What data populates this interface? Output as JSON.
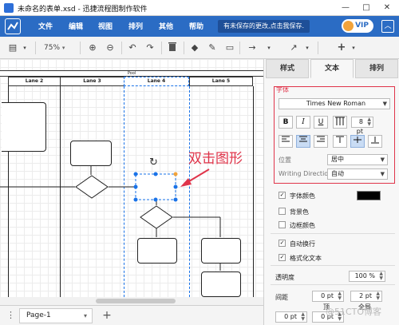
{
  "window": {
    "title": "未命名的表单.xsd - 迅捷流程图制作软件",
    "min_glyph": "—",
    "max_glyph": "□",
    "close_glyph": "✕"
  },
  "menubar": {
    "items": [
      "文件",
      "编辑",
      "视图",
      "排列",
      "其他",
      "帮助"
    ],
    "notice": "有未保存的更改,点击我保存.",
    "vip_label": "VIP",
    "collapse_glyph": "︿"
  },
  "toolbar": {
    "zoom": "75%",
    "icons": [
      "panel-toggle-icon",
      "zoom-in-icon",
      "zoom-out-icon",
      "undo-icon",
      "redo-icon",
      "delete-icon",
      "fill-color-icon",
      "line-color-icon",
      "shadow-icon",
      "connector-icon",
      "waypoint-icon",
      "insert-icon"
    ],
    "glyphs": {
      "panel": "▤",
      "zoom_in": "⊕",
      "zoom_out": "⊖",
      "undo": "↶",
      "redo": "↷",
      "delete": "🗑",
      "fill": "◆",
      "line": "✎",
      "shadow": "▭",
      "connector": "→",
      "waypoint": "↗",
      "insert": "+"
    }
  },
  "canvas": {
    "pool_label": "Pool",
    "lanes": [
      "Lane 2",
      "Lane 3",
      "Lane 4",
      "Lane 5"
    ],
    "rotate_glyph": "↻"
  },
  "annotation": {
    "text": "双击图形"
  },
  "pagebar": {
    "more_glyph": "⋮",
    "tab_label": "Page-1",
    "tab_dropdown": "▾",
    "add_glyph": "+"
  },
  "panel": {
    "tabs": [
      "样式",
      "文本",
      "排列"
    ],
    "active_tab": "文本",
    "font_group_label": "字体",
    "font_family": "Times New Roman",
    "font_size": "8 pt",
    "style_buttons": [
      "B",
      "I",
      "U"
    ],
    "position_label": "位置",
    "position_value": "居中",
    "writing_direction_label": "Writing Direction",
    "writing_direction_value": "自动",
    "font_color_label": "字体颜色",
    "font_color": "#000000",
    "background_label": "背景色",
    "border_label": "边框颜色",
    "word_wrap_label": "自动换行",
    "formatted_text_label": "格式化文本",
    "opacity_label": "透明度",
    "opacity_value": "100 %",
    "spacing_label": "间距",
    "spacing_top_value": "0 pt",
    "spacing_all_value": "2 pt",
    "spacing_top_label": "顶",
    "spacing_all_label": "全局",
    "spacing_left_value": "0 pt",
    "spacing_bottom_value": "0 pt"
  },
  "watermark": "@51CTO博客",
  "colors": {
    "brand": "#2b6cc4",
    "accent_red": "#e0344a",
    "selection": "#1a73e8"
  }
}
